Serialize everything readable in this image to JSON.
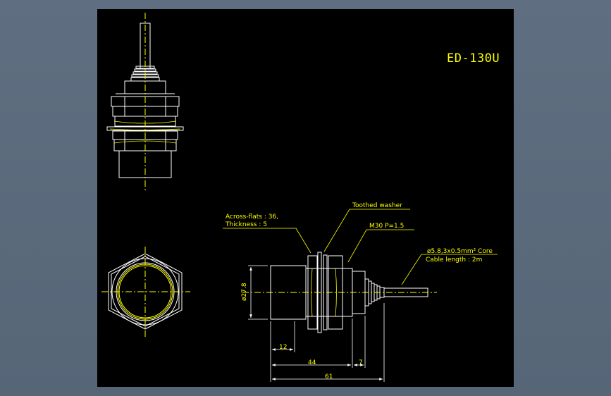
{
  "drawing": {
    "title": "ED-130U",
    "callouts": {
      "across_flats_line1": "Across-flats : 36,",
      "across_flats_line2": "Thickness : 5",
      "toothed_washer": "Toothed washer",
      "thread": "M30 P=1.5",
      "cable_line1": "ø5.8,3x0.5mm² Core",
      "cable_line2": "Cable length : 2m"
    },
    "dimensions": {
      "diameter": "ø27.8",
      "d12": "12",
      "d44": "44",
      "d7": "7",
      "d61": "61"
    },
    "colors": {
      "background": "#000000",
      "outline": "#ffffff",
      "annotation": "#ffff00",
      "centerline": "#ffff00",
      "dimension": "#ffffff"
    }
  }
}
